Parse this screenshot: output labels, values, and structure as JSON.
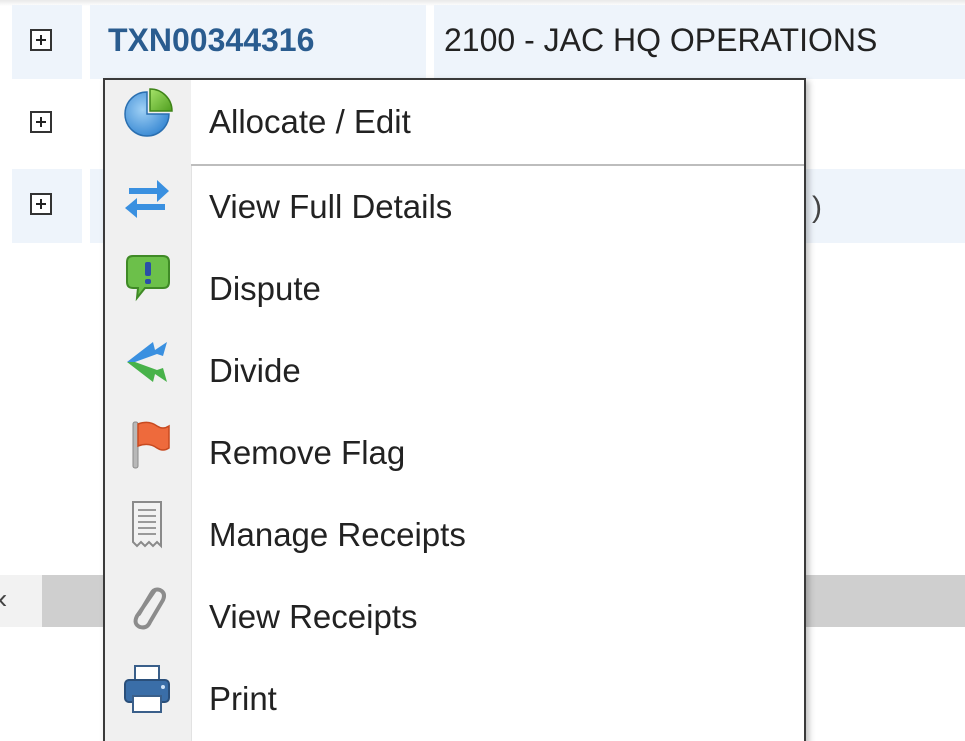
{
  "grid": {
    "rows": [
      {
        "id": "TXN00344316",
        "department": "2100 - JAC HQ OPERATIONS"
      },
      {
        "id": "",
        "department": ""
      },
      {
        "id": "",
        "department": "",
        "partial_text": ")"
      }
    ]
  },
  "scrollbar": {
    "left_arrow": "‹"
  },
  "context_menu": {
    "items": [
      {
        "label": "Allocate / Edit",
        "icon": "pie-chart-icon"
      },
      {
        "label": "View Full Details",
        "icon": "swap-arrows-icon"
      },
      {
        "label": "Dispute",
        "icon": "speech-bubble-exclamation-icon"
      },
      {
        "label": "Divide",
        "icon": "split-arrows-icon"
      },
      {
        "label": "Remove Flag",
        "icon": "flag-icon"
      },
      {
        "label": "Manage Receipts",
        "icon": "receipt-icon"
      },
      {
        "label": "View Receipts",
        "icon": "paperclip-icon"
      },
      {
        "label": "Print",
        "icon": "printer-icon"
      }
    ]
  },
  "colors": {
    "link": "#2a5c8f",
    "row_alt": "#eef4fb",
    "menu_border": "#3a3a3a",
    "icon_column": "#f0f0f0"
  }
}
